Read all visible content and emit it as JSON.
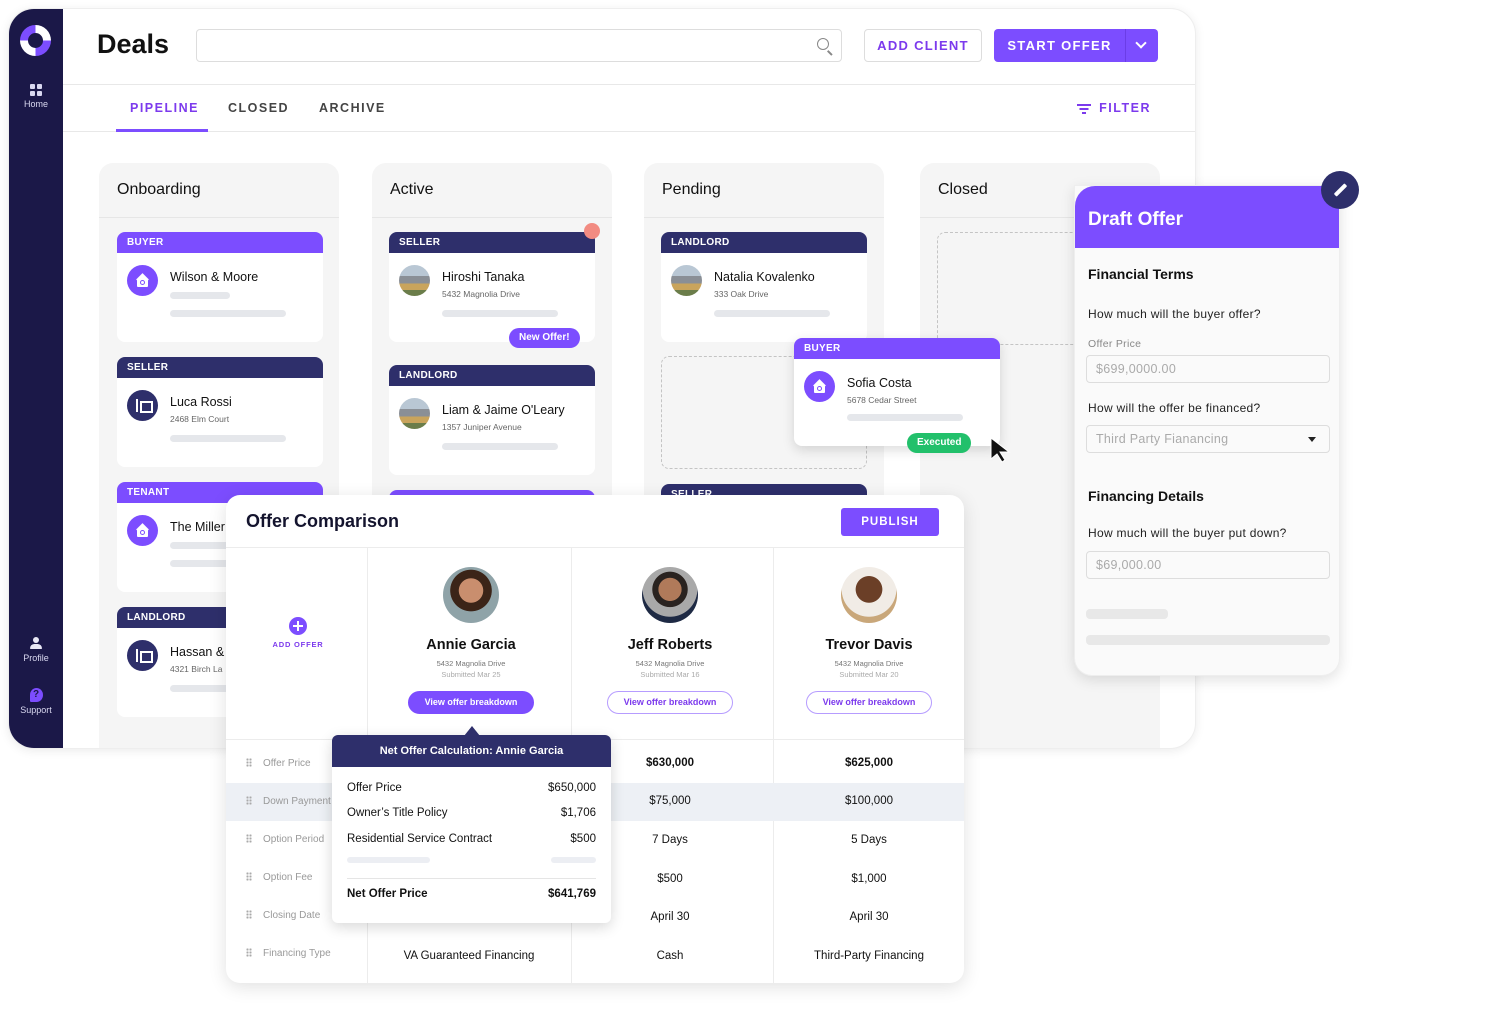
{
  "sidebar": {
    "items": [
      {
        "label": "Home",
        "icon": "grid-icon"
      },
      {
        "label": "Profile",
        "icon": "person-icon"
      },
      {
        "label": "Support",
        "icon": "help-icon"
      }
    ]
  },
  "header": {
    "title": "Deals",
    "search": {
      "value": "",
      "placeholder": ""
    },
    "add_client_label": "ADD CLIENT",
    "start_offer_label": "START OFFER"
  },
  "tabs": [
    {
      "label": "PIPELINE",
      "active": true
    },
    {
      "label": "CLOSED",
      "active": false
    },
    {
      "label": "ARCHIVE",
      "active": false
    }
  ],
  "filter_label": "FILTER",
  "columns": [
    {
      "title": "Onboarding",
      "cards": [
        {
          "type": "BUYER",
          "name": "Wilson & Moore",
          "address": ""
        },
        {
          "type": "SELLER",
          "name": "Luca Rossi",
          "address": "2468 Elm Court"
        },
        {
          "type": "TENANT",
          "name": "The Miller",
          "address": ""
        },
        {
          "type": "LANDLORD",
          "name": "Hassan &",
          "address": "4321 Birch La"
        }
      ]
    },
    {
      "title": "Active",
      "cards": [
        {
          "type": "SELLER",
          "name": "Hiroshi Tanaka",
          "address": "5432 Magnolia Drive",
          "badge": "New Offer!"
        },
        {
          "type": "LANDLORD",
          "name": "Liam & Jaime O'Leary",
          "address": "1357 Juniper Avenue"
        }
      ]
    },
    {
      "title": "Pending",
      "cards": [
        {
          "type": "LANDLORD",
          "name": "Natalia Kovalenko",
          "address": "333 Oak Drive"
        },
        {
          "type": "SELLER",
          "name": "",
          "address": ""
        }
      ]
    },
    {
      "title": "Closed",
      "cards": []
    }
  ],
  "dragging_card": {
    "type": "BUYER",
    "name": "Sofia Costa",
    "address": "5678 Cedar Street",
    "badge": "Executed"
  },
  "draft_offer": {
    "title": "Draft Offer",
    "financial_terms_heading": "Financial Terms",
    "offer_question": "How much will the buyer offer?",
    "offer_price_label": "Offer Price",
    "offer_price_value": "$699,0000.00",
    "financing_question": "How will the offer be financed?",
    "financing_value": "Third Party Fianancing",
    "financing_details_heading": "Financing Details",
    "down_question": "How much will the buyer put down?",
    "down_value": "$69,000.00"
  },
  "offer_comparison": {
    "title": "Offer Comparison",
    "publish_label": "PUBLISH",
    "add_offer_label": "ADD OFFER",
    "bidders": [
      {
        "name": "Annie Garcia",
        "address": "5432 Magnolia Drive",
        "submitted": "Submitted Mar 25",
        "button": "View offer breakdown"
      },
      {
        "name": "Jeff Roberts",
        "address": "5432 Magnolia Drive",
        "submitted": "Submitted Mar 16",
        "button": "View offer breakdown"
      },
      {
        "name": "Trevor Davis",
        "address": "5432 Magnolia Drive",
        "submitted": "Submitted Mar 20",
        "button": "View offer breakdown"
      }
    ],
    "rows": [
      {
        "label": "Offer Price",
        "values": [
          "",
          "$630,000",
          "$625,000"
        ]
      },
      {
        "label": "Down Payment",
        "values": [
          "",
          "$75,000",
          "$100,000"
        ]
      },
      {
        "label": "Option Period",
        "values": [
          "",
          "7 Days",
          "5 Days"
        ]
      },
      {
        "label": "Option Fee",
        "values": [
          "",
          "$500",
          "$1,000"
        ]
      },
      {
        "label": "Closing Date",
        "values": [
          "",
          "April 30",
          "April 30"
        ]
      },
      {
        "label": "Financing Type",
        "values": [
          "VA Guaranteed Financing",
          "Cash",
          "Third-Party Financing"
        ]
      }
    ]
  },
  "net_offer": {
    "title": "Net Offer Calculation: Annie Garcia",
    "lines": [
      {
        "label": "Offer Price",
        "value": "$650,000"
      },
      {
        "label": "Owner’s Title Policy",
        "value": "$1,706"
      },
      {
        "label": "Residential Service Contract",
        "value": "$500"
      }
    ],
    "total_label": "Net Offer Price",
    "total_value": "$641,769"
  },
  "colors": {
    "accent": "#7c4dff",
    "navy": "#2e2f6b",
    "sidebar": "#1b1848",
    "executed": "#22c06b",
    "notification": "#f28b82"
  }
}
